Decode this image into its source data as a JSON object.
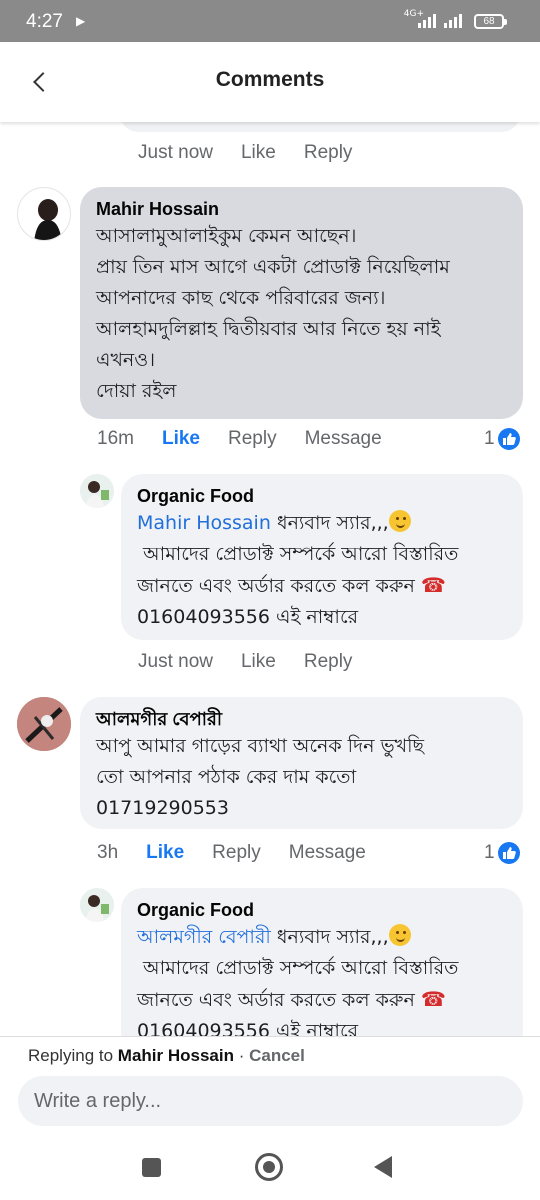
{
  "status_bar": {
    "time": "4:27",
    "network": "4G+",
    "battery": "68"
  },
  "header": {
    "title": "Comments"
  },
  "previous_comment_meta": {
    "time": "Just now",
    "like": "Like",
    "reply": "Reply"
  },
  "comments": [
    {
      "author": "Mahir Hossain",
      "lines": [
        "আসালামুআলাইকুম কেমন আছেন।",
        "প্রায় তিন মাস আগে একটা প্রোডাক্ট নিয়েছিলাম",
        "আপনাদের কাছ থেকে পরিবারের জন্য।",
        "আলহামদুলিল্লাহ দ্বিতীয়বার আর নিতে হয় নাই",
        "এখনও।",
        "দোয়া রইল"
      ],
      "time": "16m",
      "like": "Like",
      "reply": "Reply",
      "message": "Message",
      "reactions": "1",
      "reply_item": {
        "author": "Organic Food",
        "tag": "Mahir Hossain",
        "line1": "ধন্যবাদ স্যার,,,",
        "line2": "আমাদের প্রোডাক্ট সম্পর্কে আরো বিস্তারিত",
        "line3": "জানতে এবং অর্ডার করতে কল করুন",
        "line4": "01604093556 এই নাম্বারে",
        "time": "Just now",
        "like": "Like",
        "reply": "Reply"
      }
    },
    {
      "author": "আলমগীর বেপারী",
      "lines": [
        "আপু আমার গাড়ের ব্যাথা অনেক দিন ভুখছি",
        "তো আপনার পঠাক কের দাম কতো",
        "01719290553"
      ],
      "time": "3h",
      "like": "Like",
      "reply": "Reply",
      "message": "Message",
      "reactions": "1",
      "reply_item": {
        "author": "Organic Food",
        "tag": "আলমগীর বেপারী",
        "line1": "ধন্যবাদ স্যার,,,",
        "line2": "আমাদের প্রোডাক্ট সম্পর্কে আরো বিস্তারিত",
        "line3": "জানতে এবং অর্ডার করতে কল করুন",
        "line4": "01604093556 এই নাম্বারে"
      }
    }
  ],
  "reply_bar": {
    "prefix": "Replying to",
    "name": "Mahir Hossain",
    "separator": " · ",
    "cancel": "Cancel"
  },
  "composer": {
    "placeholder": "Write a reply..."
  },
  "colors": {
    "accent": "#1877f2",
    "bubble": "#f0f2f5",
    "highlight_bubble": "#d8dadf",
    "muted": "#65676b"
  }
}
